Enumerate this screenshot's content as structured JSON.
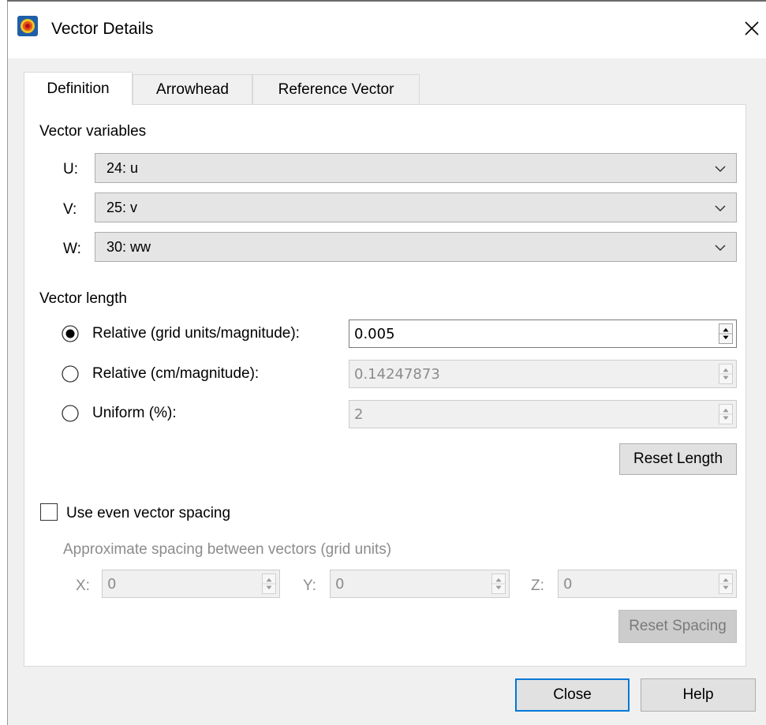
{
  "window": {
    "title": "Vector Details",
    "icon": "tecplot-app-icon",
    "close_icon": "close-icon"
  },
  "tabs": [
    {
      "label": "Definition",
      "active": true
    },
    {
      "label": "Arrowhead",
      "active": false
    },
    {
      "label": "Reference Vector",
      "active": false
    }
  ],
  "vector_variables": {
    "heading": "Vector variables",
    "u": {
      "label": "U:",
      "value": "24: u"
    },
    "v": {
      "label": "V:",
      "value": "25: v"
    },
    "w": {
      "label": "W:",
      "value": "30: ww"
    }
  },
  "vector_length": {
    "heading": "Vector length",
    "options": [
      {
        "label": "Relative (grid units/magnitude):",
        "value": "0.005",
        "selected": true
      },
      {
        "label": "Relative (cm/magnitude):",
        "value": "0.14247873",
        "selected": false
      },
      {
        "label": "Uniform (%):",
        "value": "2",
        "selected": false
      }
    ],
    "reset_label": "Reset Length"
  },
  "spacing": {
    "checkbox_label": "Use even vector spacing",
    "checked": false,
    "caption": "Approximate spacing between vectors (grid units)",
    "x": {
      "label": "X:",
      "value": "0"
    },
    "y": {
      "label": "Y:",
      "value": "0"
    },
    "z": {
      "label": "Z:",
      "value": "0"
    },
    "reset_label": "Reset Spacing"
  },
  "footer": {
    "close_label": "Close",
    "help_label": "Help"
  },
  "colors": {
    "accent": "#0078d7",
    "disabled_text": "#8c8c8c"
  }
}
